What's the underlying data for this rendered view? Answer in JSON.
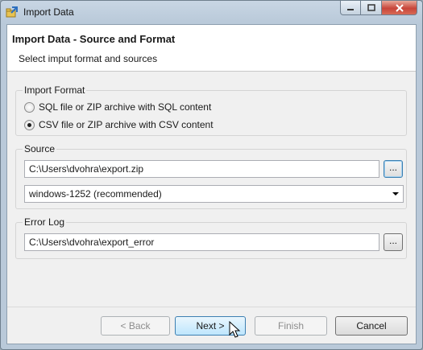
{
  "window": {
    "title": "Import Data",
    "icons": {
      "app": "import-data-icon",
      "minimize": "minimize-icon",
      "maximize": "maximize-icon",
      "close": "close-icon"
    }
  },
  "header": {
    "title": "Import Data - Source and Format",
    "subtitle": "Select imput format and sources"
  },
  "import_format": {
    "label": "Import Format",
    "options": [
      {
        "label": "SQL file or ZIP archive with SQL content",
        "checked": false
      },
      {
        "label": "CSV file or ZIP archive with CSV content",
        "checked": true
      }
    ]
  },
  "source": {
    "label": "Source",
    "path_value": "C:\\Users\\dvohra\\export.zip",
    "browse_label": "...",
    "encoding_value": "windows-1252 (recommended)"
  },
  "error_log": {
    "label": "Error Log",
    "path_value": "C:\\Users\\dvohra\\export_error",
    "browse_label": "..."
  },
  "buttons": {
    "back": "< Back",
    "next": "Next >",
    "finish": "Finish",
    "cancel": "Cancel"
  }
}
